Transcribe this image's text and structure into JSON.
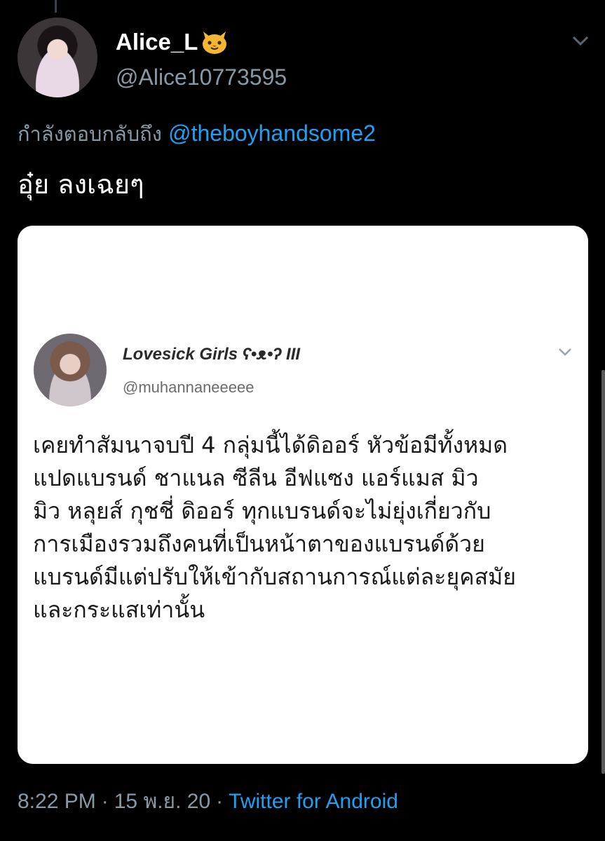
{
  "tweet": {
    "display_name": "Alice_L",
    "name_emoji": "cat-face-icon",
    "handle": "@Alice10773595",
    "reply_prefix": "กำลังตอบกลับถึง",
    "reply_mention": "@theboyhandsome2",
    "text": "อุ๋ย ลงเฉยๆ",
    "time": "8:22 PM",
    "date": "15 พ.ย. 20",
    "separator": "·",
    "source": "Twitter for Android"
  },
  "embedded": {
    "display_name": "Lovesick Girls ʕ•ᴥ•ʔ III",
    "handle": "@muhannaneeeee",
    "lines": [
      "เคยทำสัมนาจบปี 4 กลุ่มนี้ได้ดิออร์ หัวข้อมีทั้งหมด",
      "แปดแบรนด์ ชาแนล ซีลีน อีฟแซง แอร์แมส มิว",
      "มิว หลุยส์ กุชชี่ ดิออร์ ทุกแบรนด์จะไม่ยุ่งเกี่ยวกับ",
      "การเมืองรวมถึงคนที่เป็นหน้าตาของแบรนด์ด้วย",
      "แบรนด์มีแต่ปรับให้เข้ากับสถานการณ์แต่ละยุคสมัย",
      "และกระแสเท่านั้น"
    ]
  },
  "colors": {
    "background": "#000000",
    "muted": "#8899a6",
    "link": "#1da1f2",
    "card": "#ffffff"
  }
}
